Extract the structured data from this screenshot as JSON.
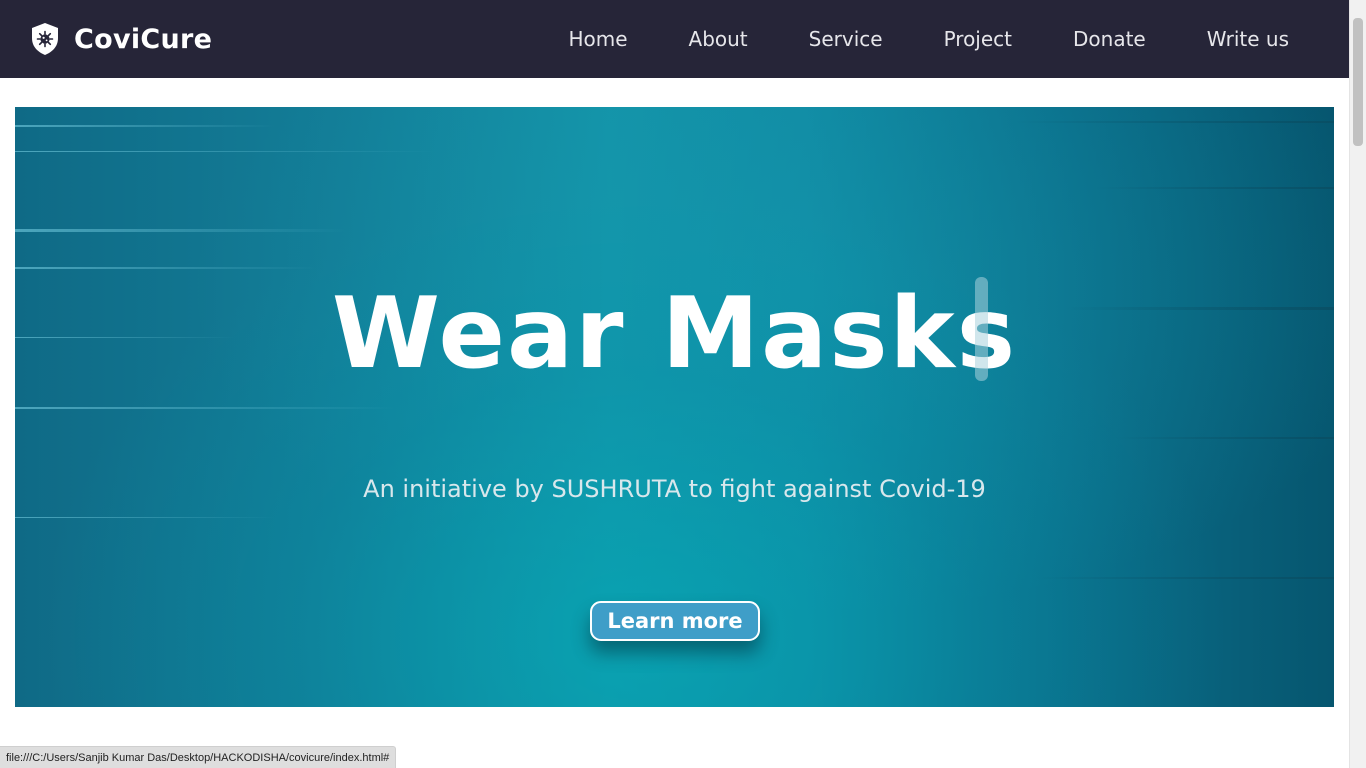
{
  "navbar": {
    "brand": "CoviCure",
    "links": [
      "Home",
      "About",
      "Service",
      "Project",
      "Donate",
      "Write us"
    ]
  },
  "hero": {
    "title": "Wear Masks",
    "subtitle": "An initiative by SUSHRUTA to fight against Covid-19",
    "button_label": "Learn more"
  },
  "status_bar": {
    "url": "file:///C:/Users/Sanjib Kumar Das/Desktop/HACKODISHA/covicure/index.html#"
  },
  "icons": {
    "brand": "shield-virus-icon"
  },
  "colors": {
    "navbar_bg": "#262538",
    "hero_teal": "#1493a8",
    "button_bg": "#3f9ec8",
    "text_white": "#ffffff"
  }
}
